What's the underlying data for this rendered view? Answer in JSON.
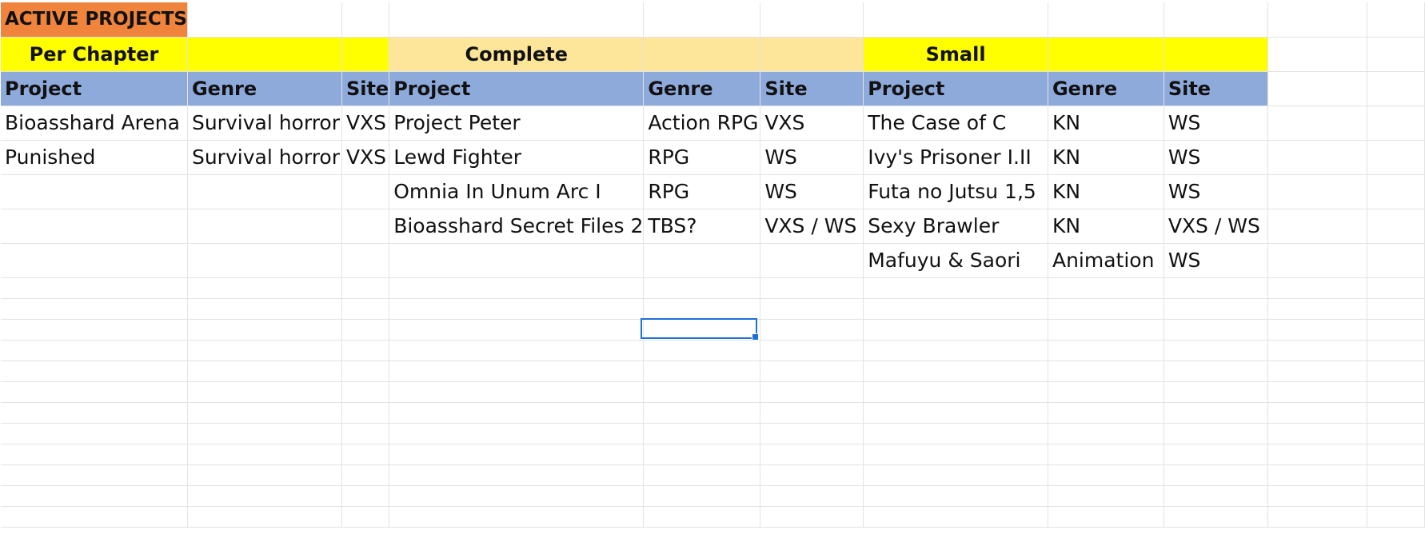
{
  "title": "ACTIVE PROJECTS",
  "groups": {
    "per_chapter": "Per Chapter",
    "complete": "Complete",
    "small": "Small"
  },
  "headers": {
    "project": "Project",
    "genre": "Genre",
    "site": "Site"
  },
  "per_chapter": [
    {
      "project": "Bioasshard Arena",
      "genre": "Survival horror",
      "site": "VXS"
    },
    {
      "project": "Punished",
      "genre": "Survival horror",
      "site": "VXS"
    }
  ],
  "complete": [
    {
      "project": "Project Peter",
      "genre": "Action RPG",
      "site": "VXS"
    },
    {
      "project": "Lewd Fighter",
      "genre": "RPG",
      "site": "WS"
    },
    {
      "project": "Omnia In Unum Arc I",
      "genre": "RPG",
      "site": "WS"
    },
    {
      "project": "Bioasshard Secret Files 2",
      "genre": "TBS?",
      "site": "VXS / WS"
    }
  ],
  "small": [
    {
      "project": "The Case of C",
      "genre": "KN",
      "site": "WS"
    },
    {
      "project": "Ivy's Prisoner I.II",
      "genre": "KN",
      "site": "WS"
    },
    {
      "project": "Futa no Jutsu 1,5",
      "genre": "KN",
      "site": "WS"
    },
    {
      "project": "Sexy Brawler",
      "genre": "KN",
      "site": "VXS / WS"
    },
    {
      "project": "Mafuyu & Saori",
      "genre": "Animation",
      "site": "WS"
    }
  ],
  "colors": {
    "title_fill": "#f0843c",
    "group_yellow": "#ffff00",
    "group_beige": "#fde599",
    "header_fill": "#8eaadb",
    "selection": "#1f6fd6",
    "gridline": "#e3e3e3"
  }
}
